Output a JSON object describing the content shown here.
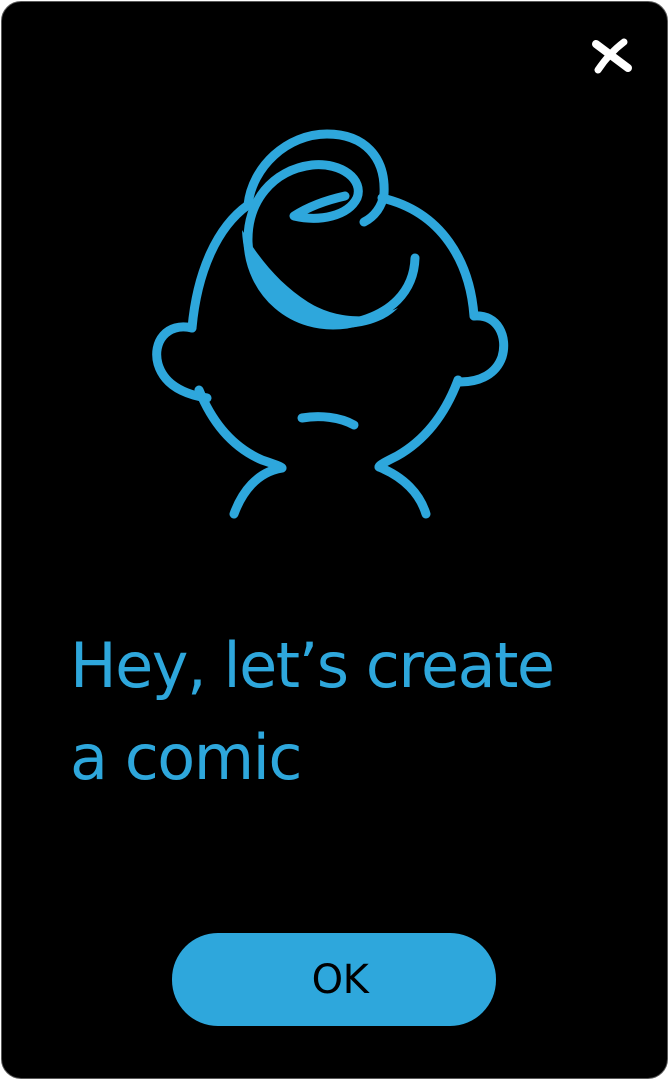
{
  "dialog": {
    "close_icon": "close-icon",
    "illustration_icon": "baby-head-icon",
    "headline_line1": "Hey, let’s create",
    "headline_line2": "a comic",
    "ok_label": "OK"
  },
  "colors": {
    "accent": "#2ea7dc",
    "background": "#000000",
    "close_icon": "#ffffff",
    "button_text": "#000000"
  }
}
